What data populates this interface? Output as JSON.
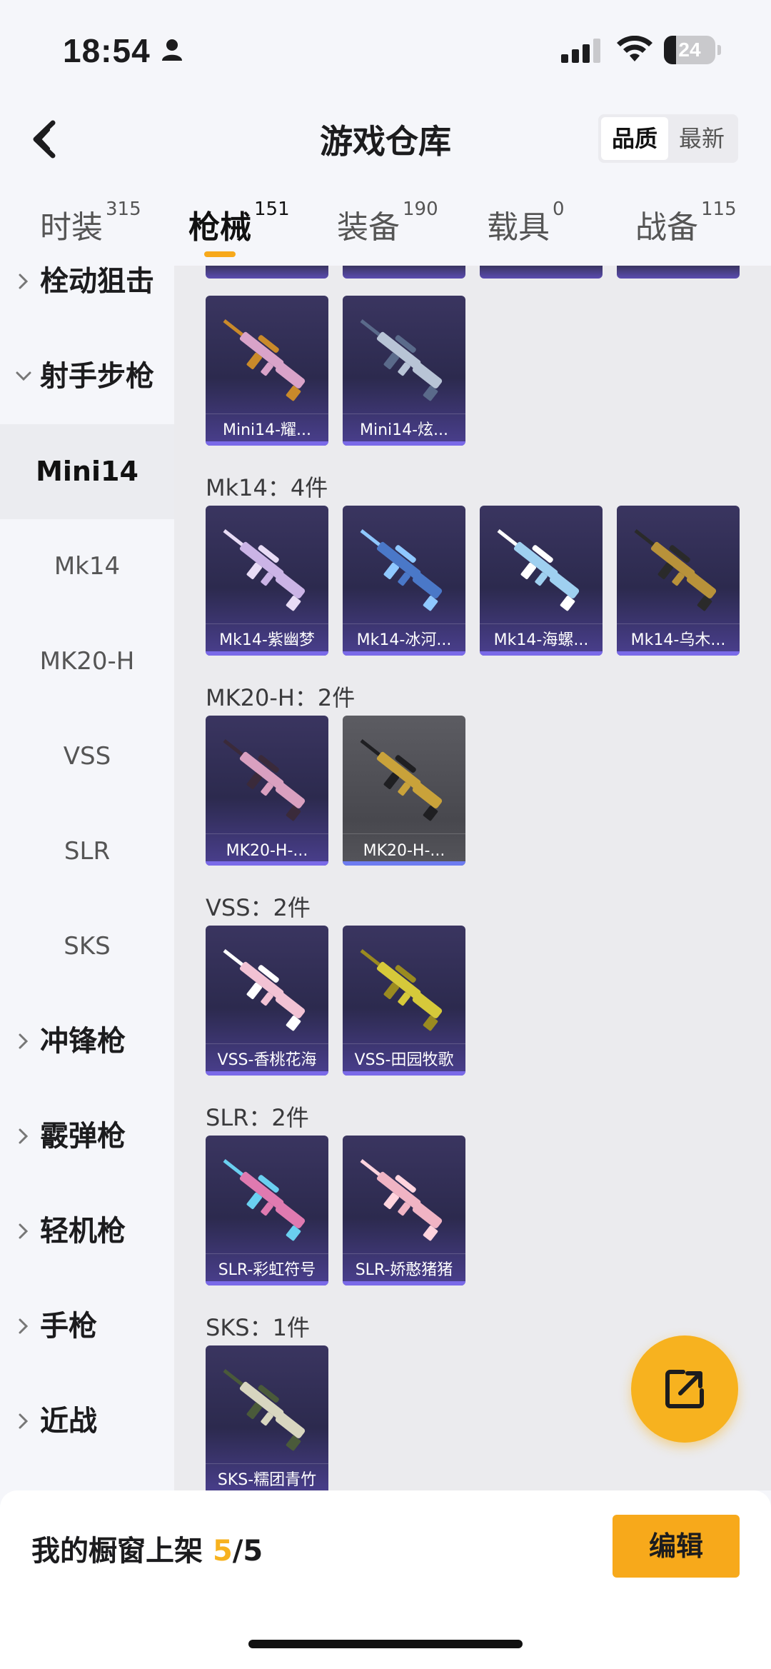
{
  "status_bar": {
    "time": "18:54",
    "battery": "24",
    "battery_level": 0.24
  },
  "header": {
    "title": "游戏仓库",
    "sort_options": [
      "品质",
      "最新"
    ],
    "active_sort": "品质"
  },
  "tabs": [
    {
      "label": "时装",
      "count": "315"
    },
    {
      "label": "枪械",
      "count": "151",
      "active": true
    },
    {
      "label": "装备",
      "count": "190"
    },
    {
      "label": "载具",
      "count": "0"
    },
    {
      "label": "战备",
      "count": "115"
    }
  ],
  "sidebar": [
    {
      "label": "栓动狙击",
      "type": "category",
      "expanded": false
    },
    {
      "label": "射手步枪",
      "type": "category",
      "expanded": true
    },
    {
      "label": "Mini14",
      "type": "sub",
      "selected": true
    },
    {
      "label": "Mk14",
      "type": "sub"
    },
    {
      "label": "MK20-H",
      "type": "sub"
    },
    {
      "label": "VSS",
      "type": "sub"
    },
    {
      "label": "SLR",
      "type": "sub"
    },
    {
      "label": "SKS",
      "type": "sub"
    },
    {
      "label": "冲锋枪",
      "type": "category",
      "expanded": false
    },
    {
      "label": "霰弹枪",
      "type": "category",
      "expanded": false
    },
    {
      "label": "轻机枪",
      "type": "category",
      "expanded": false
    },
    {
      "label": "手枪",
      "type": "category",
      "expanded": false
    },
    {
      "label": "近战",
      "type": "category",
      "expanded": false
    }
  ],
  "sections": [
    {
      "title": "",
      "items": [
        {
          "name": "Mini14-耀...",
          "gun_color": "#d9a3c9",
          "accent": "#c98a2a"
        },
        {
          "name": "Mini14-炫...",
          "gun_color": "#b8c4d6",
          "accent": "#5a6a8a"
        }
      ]
    },
    {
      "title": "Mk14：4件",
      "items": [
        {
          "name": "Mk14-紫幽梦",
          "gun_color": "#cbb4e6",
          "accent": "#e8dcf5"
        },
        {
          "name": "Mk14-冰河...",
          "gun_color": "#4a78c8",
          "accent": "#8fc8ff"
        },
        {
          "name": "Mk14-海螺...",
          "gun_color": "#9fd0f0",
          "accent": "#ffffff"
        },
        {
          "name": "Mk14-乌木...",
          "gun_color": "#b8923a",
          "accent": "#2a2a2a"
        }
      ]
    },
    {
      "title": "MK20-H：2件",
      "items": [
        {
          "name": "MK20-H-...",
          "gun_color": "#d9a0c0",
          "accent": "#3a2a3a"
        },
        {
          "name": "MK20-H-...",
          "gun_color": "#c9a23a",
          "accent": "#1f1f22",
          "gray": true
        }
      ]
    },
    {
      "title": "VSS：2件",
      "items": [
        {
          "name": "VSS-香桃花海",
          "gun_color": "#f2c2d4",
          "accent": "#ffffff"
        },
        {
          "name": "VSS-田园牧歌",
          "gun_color": "#d6c93a",
          "accent": "#9a8a20"
        }
      ]
    },
    {
      "title": "SLR：2件",
      "items": [
        {
          "name": "SLR-彩虹符号",
          "gun_color": "#e07ab0",
          "accent": "#6ad0f0"
        },
        {
          "name": "SLR-娇憨猪猪",
          "gun_color": "#f0b4c4",
          "accent": "#ffd4de"
        }
      ]
    },
    {
      "title": "SKS：1件",
      "items": [
        {
          "name": "SKS-糯团青竹",
          "gun_color": "#d8d6c0",
          "accent": "#4a5a3a"
        }
      ]
    }
  ],
  "bottom": {
    "label": "我的橱窗上架",
    "count": "5",
    "total": "/5",
    "edit_label": "编辑"
  }
}
